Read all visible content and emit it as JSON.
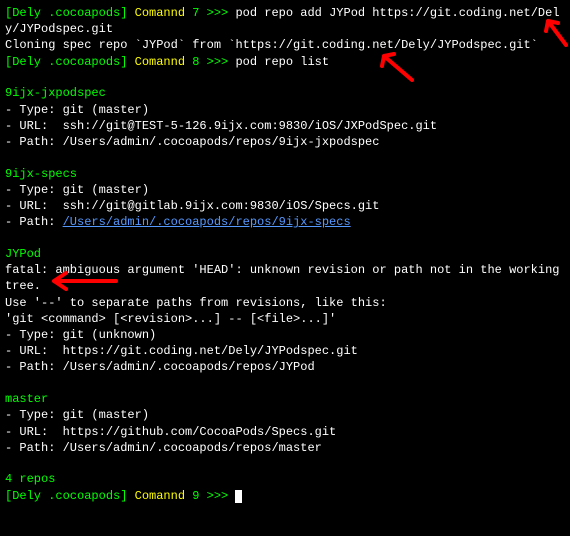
{
  "prompt": {
    "prefix": "[Dely .cocoapods]",
    "label": "Comannd"
  },
  "commands": {
    "cmd7": "pod repo add JYPod https://git.coding.net/Dely/JYPodspec.git",
    "cmd8": "pod repo list",
    "cmd9": ""
  },
  "clone_msg": "Cloning spec repo `JYPod` from `https://git.coding.net/Dely/JYPodspec.git`",
  "repo1": {
    "name": "9ijx-jxpodspec",
    "type": "- Type: git (master)",
    "url": "- URL:  ssh://git@TEST-5-126.9ijx.com:9830/iOS/JXPodSpec.git",
    "path": "- Path: /Users/admin/.cocoapods/repos/9ijx-jxpodspec"
  },
  "repo2": {
    "name": "9ijx-specs",
    "type": "- Type: git (master)",
    "url": "- URL:  ssh://git@gitlab.9ijx.com:9830/iOS/Specs.git",
    "path_prefix": "- Path: ",
    "path_link": "/Users/admin/.cocoapods/repos/9ijx-specs"
  },
  "repo3": {
    "name": "JYPod",
    "err1": "fatal: ambiguous argument 'HEAD': unknown revision or path not in the working tree.",
    "err2": "Use '--' to separate paths from revisions, like this:",
    "err3": "'git <command> [<revision>...] -- [<file>...]'",
    "type": "- Type: git (unknown)",
    "url": "- URL:  https://git.coding.net/Dely/JYPodspec.git",
    "path": "- Path: /Users/admin/.cocoapods/repos/JYPod"
  },
  "repo4": {
    "name": "master",
    "type": "- Type: git (master)",
    "url": "- URL:  https://github.com/CocoaPods/Specs.git",
    "path": "- Path: /Users/admin/.cocoapods/repos/master"
  },
  "summary": "4 repos"
}
